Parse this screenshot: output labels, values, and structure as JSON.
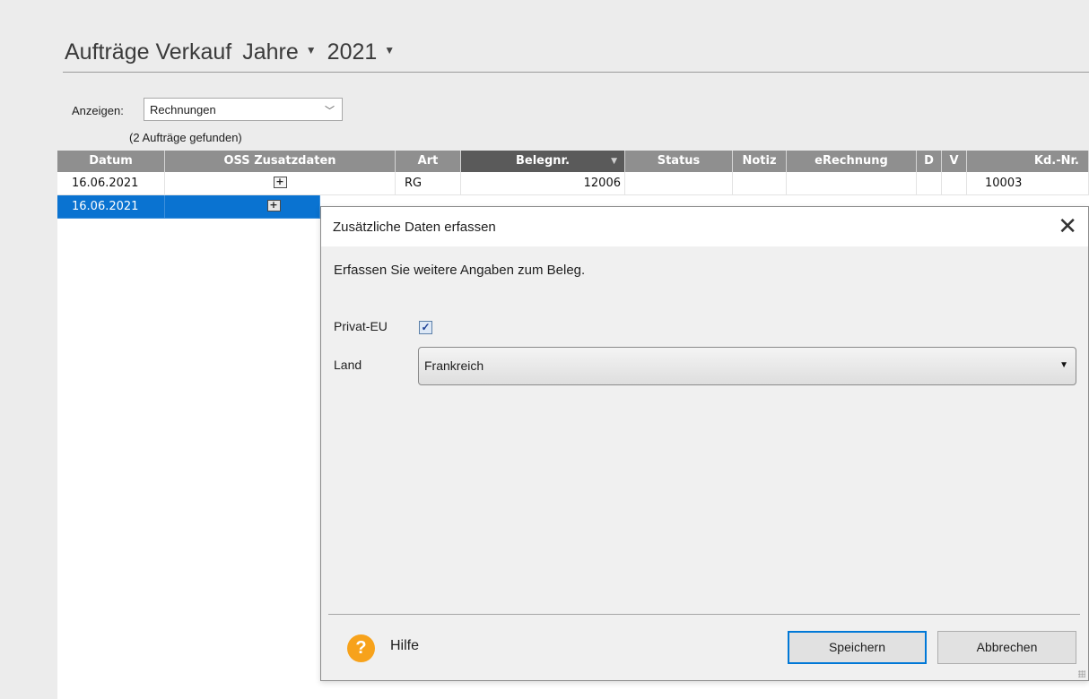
{
  "header": {
    "title": "Aufträge Verkauf",
    "period_label": "Jahre",
    "year": "2021"
  },
  "filter": {
    "label": "Anzeigen:",
    "selected": "Rechnungen",
    "found_text": "(2 Aufträge gefunden)"
  },
  "grid": {
    "columns": [
      "Datum",
      "OSS Zusatzdaten",
      "Art",
      "Belegnr.",
      "Status",
      "Notiz",
      "eRechnung",
      "D",
      "V",
      "Kd.-Nr."
    ],
    "sorted_column": "Belegnr.",
    "rows": [
      {
        "datum": "16.06.2021",
        "oss": "+",
        "art": "RG",
        "belegnr": "12006",
        "status": "",
        "notiz": "",
        "erechnung": "",
        "d": "",
        "v": "",
        "kdnr": "10003",
        "selected": false
      },
      {
        "datum": "16.06.2021",
        "oss": "+",
        "art": "",
        "belegnr": "",
        "status": "",
        "notiz": "",
        "erechnung": "",
        "d": "",
        "v": "",
        "kdnr": "",
        "selected": true
      }
    ]
  },
  "dialog": {
    "title": "Zusätzliche Daten erfassen",
    "description": "Erfassen Sie weitere Angaben zum Beleg.",
    "privat_eu_label": "Privat-EU",
    "privat_eu_checked": true,
    "land_label": "Land",
    "land_value": "Frankreich",
    "help_label": "Hilfe",
    "save_label": "Speichern",
    "cancel_label": "Abbrechen"
  },
  "colors": {
    "selection": "#0a73d1",
    "header_bg": "#8f8f8f",
    "sorted_header_bg": "#5a5a5a",
    "help_icon": "#f7a21b",
    "default_button_border": "#0078d7"
  },
  "icons": {
    "period_dropdown": "caret-down-icon",
    "year_dropdown": "caret-down-icon",
    "filter_dropdown": "chevron-down-icon",
    "oss_expand": "plus-box-icon",
    "close": "close-icon",
    "help": "question-icon"
  }
}
